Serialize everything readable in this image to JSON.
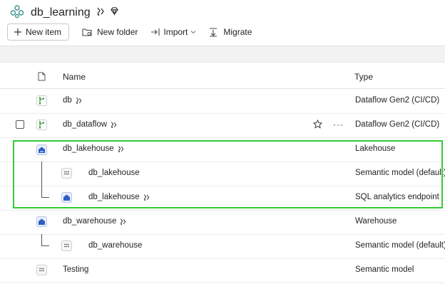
{
  "workspace": {
    "title": "db_learning"
  },
  "toolbar": {
    "new_item": "New item",
    "new_folder": "New folder",
    "import": "Import",
    "migrate": "Migrate"
  },
  "table": {
    "headers": {
      "name": "Name",
      "type": "Type"
    },
    "rows": [
      {
        "name": "db",
        "type": "Dataflow Gen2 (CI/CD)"
      },
      {
        "name": "db_dataflow",
        "type": "Dataflow Gen2 (CI/CD)"
      },
      {
        "name": "db_lakehouse",
        "type": "Lakehouse"
      },
      {
        "name": "db_lakehouse",
        "type": "Semantic model (default)"
      },
      {
        "name": "db_lakehouse",
        "type": "SQL analytics endpoint"
      },
      {
        "name": "db_warehouse",
        "type": "Warehouse"
      },
      {
        "name": "db_warehouse",
        "type": "Semantic model (default)"
      },
      {
        "name": "Testing",
        "type": "Semantic model"
      }
    ]
  },
  "colors": {
    "highlight": "#33cc33",
    "dataflow_green": "#3f9a3f",
    "lakehouse_blue": "#2f5fc4"
  }
}
